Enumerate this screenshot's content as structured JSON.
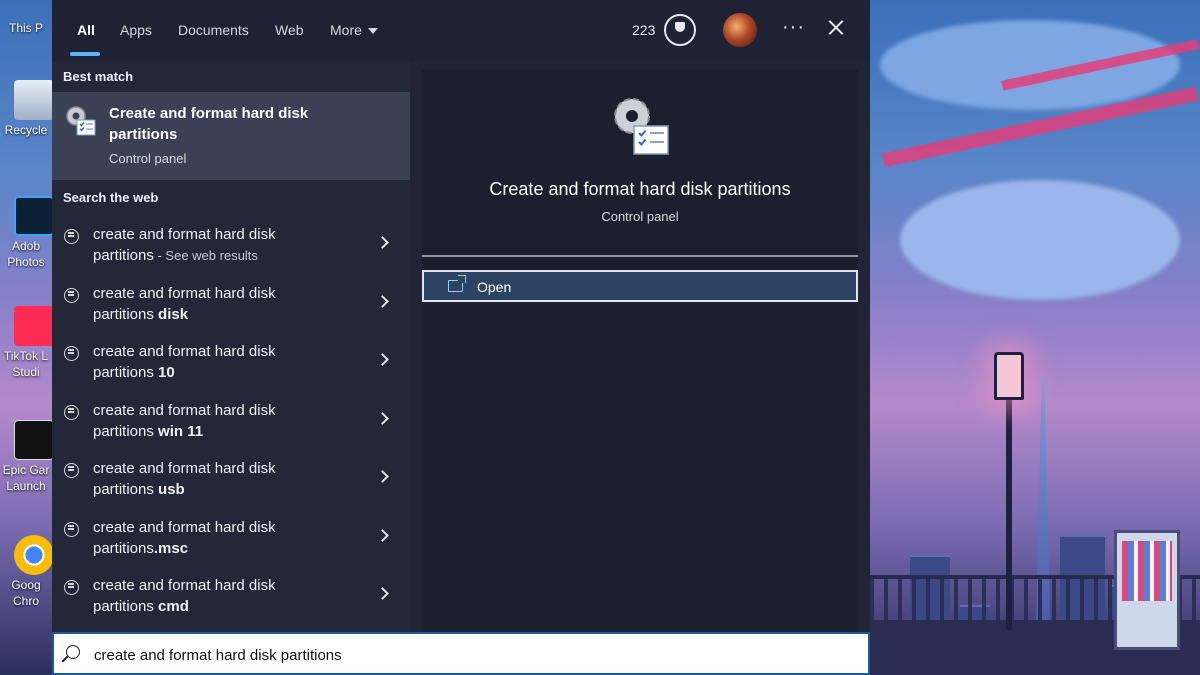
{
  "desktop": {
    "icons": [
      {
        "name": "this-pc",
        "label": "This P"
      },
      {
        "name": "recycle-bin",
        "label": "Recycle"
      },
      {
        "name": "adobe-photoshop",
        "label1": "Adob",
        "label2": "Photos"
      },
      {
        "name": "tiktok-live-studio",
        "label1": "TikTok L",
        "label2": "Studi"
      },
      {
        "name": "epic-games-launcher",
        "label1": "Epic Gar",
        "label2": "Launch"
      },
      {
        "name": "google-chrome",
        "label1": "Goog",
        "label2": "Chro"
      }
    ]
  },
  "tabs": [
    {
      "label": "All",
      "active": true
    },
    {
      "label": "Apps"
    },
    {
      "label": "Documents"
    },
    {
      "label": "Web"
    },
    {
      "label": "More"
    }
  ],
  "header": {
    "points": "223",
    "reward_icon": "trophy-medal-icon",
    "more_options": "···",
    "close_icon": "close-icon"
  },
  "best_match": {
    "section_title": "Best match",
    "title": "Create and format hard disk partitions",
    "subtitle": "Control panel",
    "icon": "gear-checklist-icon"
  },
  "web_search": {
    "section_title": "Search the web",
    "items": [
      {
        "line1": "create and format hard disk",
        "line2": "partitions",
        "suffix": " - See web results"
      },
      {
        "line1": "create and format hard disk",
        "line2": "partitions ",
        "bold": "disk"
      },
      {
        "line1": "create and format hard disk",
        "line2": "partitions ",
        "bold": "10"
      },
      {
        "line1": "create and format hard disk",
        "line2": "partitions ",
        "bold": "win 11"
      },
      {
        "line1": "create and format hard disk",
        "line2": "partitions ",
        "bold": "usb"
      },
      {
        "line1": "create and format hard disk",
        "line2": "partitions",
        "bold": ".msc"
      },
      {
        "line1": "create and format hard disk",
        "line2": "partitions ",
        "bold": "cmd"
      }
    ]
  },
  "preview": {
    "title": "Create and format hard disk partitions",
    "subtitle": "Control panel",
    "actions": [
      {
        "label": "Open",
        "icon": "open-window-icon"
      }
    ]
  },
  "search": {
    "value": "create and format hard disk partitions"
  },
  "colors": {
    "accent": "#5fb2ff",
    "panel_bg": "#202434",
    "selected_bg": "#3b4155",
    "action_bg": "#2c4362"
  }
}
